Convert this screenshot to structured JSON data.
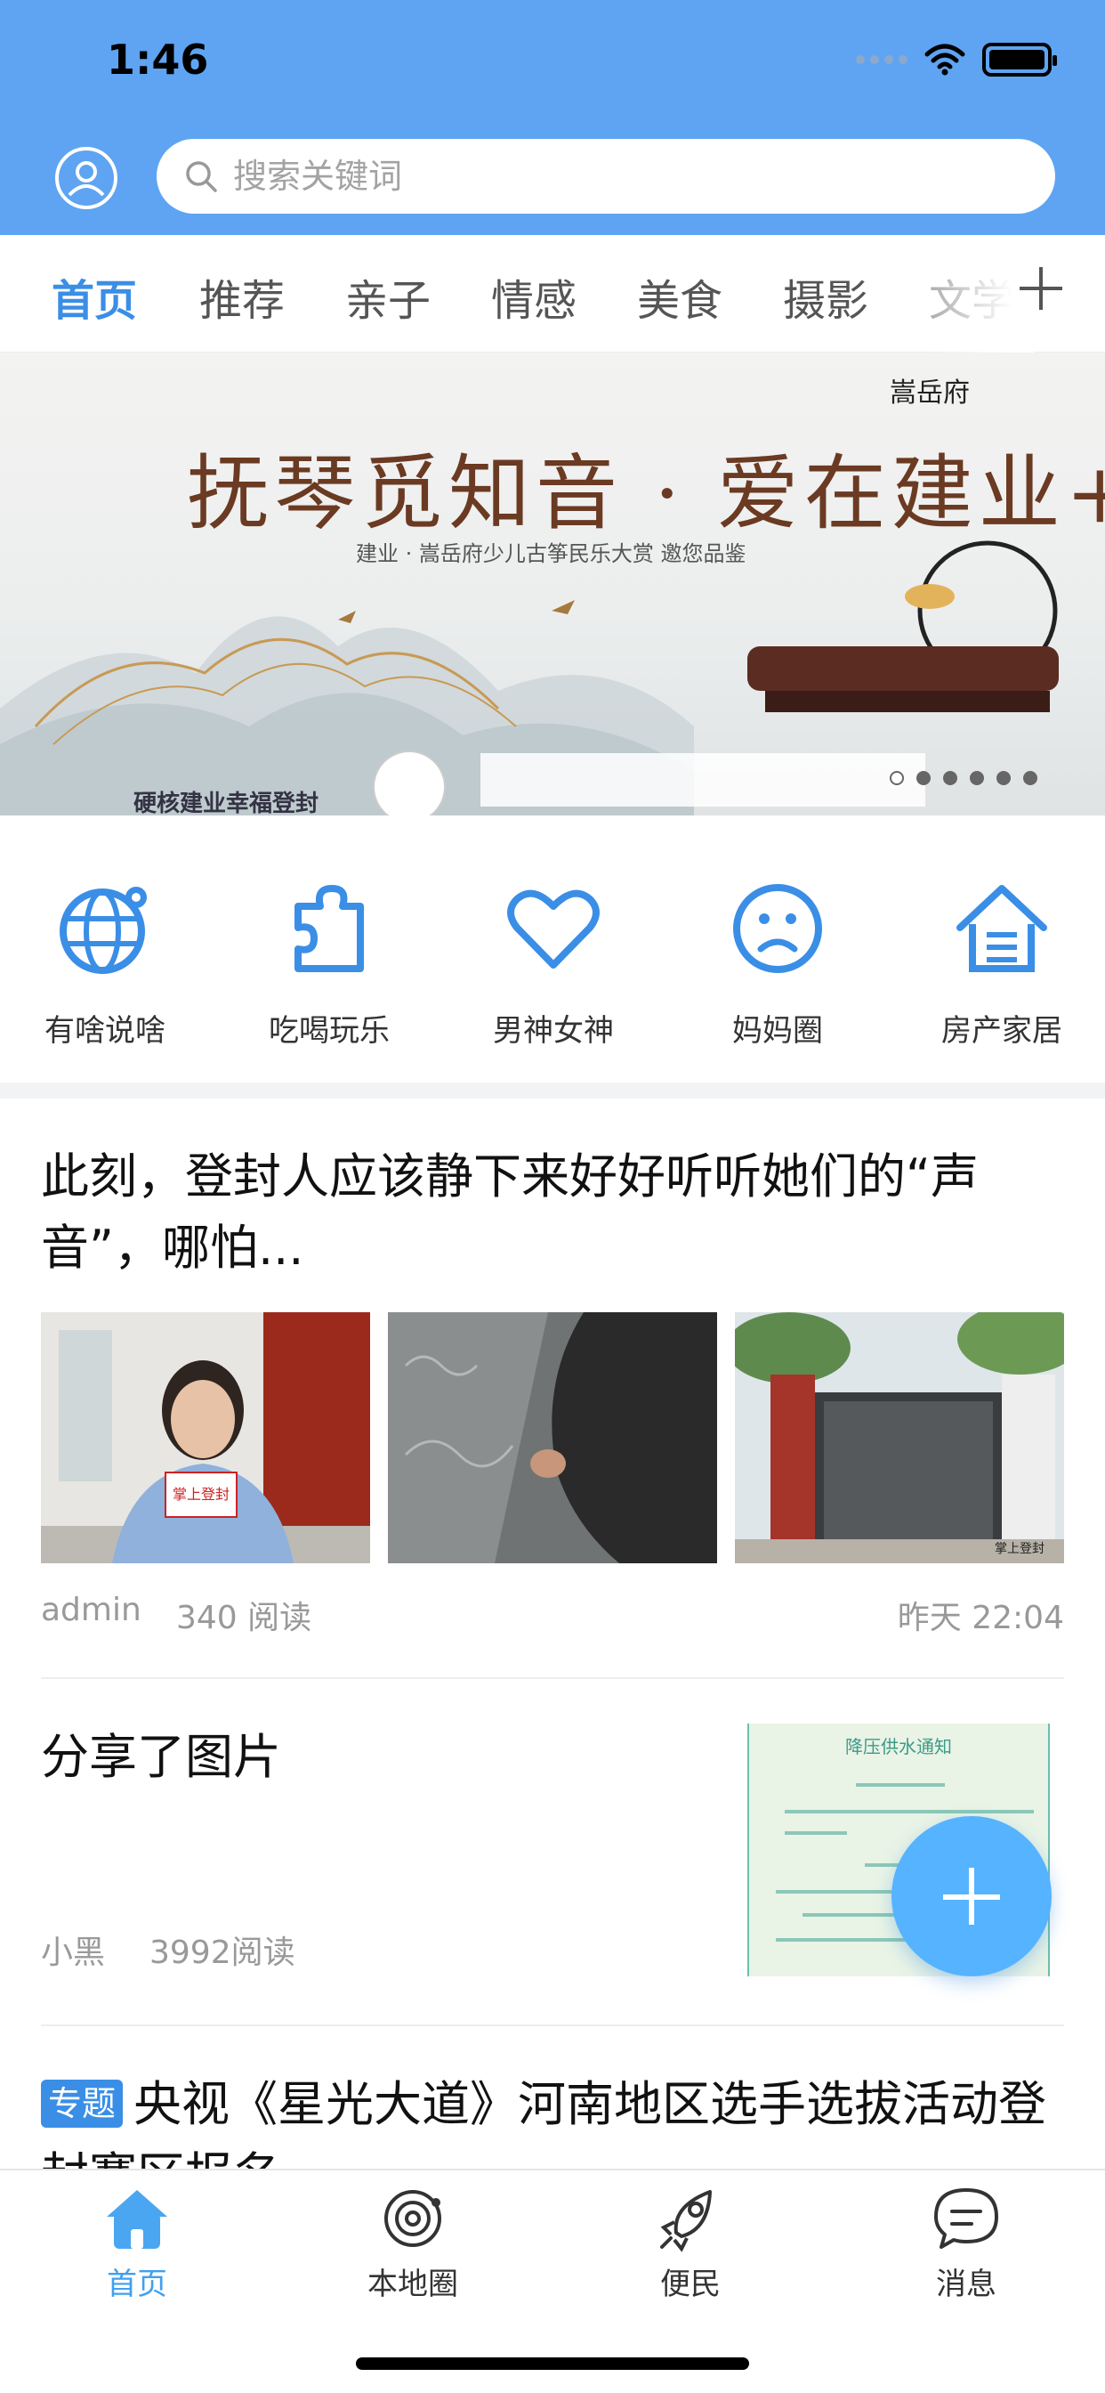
{
  "status": {
    "time": "1:46"
  },
  "search": {
    "placeholder": "搜索关键词"
  },
  "tabs": [
    "首页",
    "推荐",
    "亲子",
    "情感",
    "美食",
    "摄影",
    "文学"
  ],
  "banner": {
    "title": "抚琴觅知音 · 爱在建业+",
    "subtitle": "建业 · 嵩岳府少儿古筝民乐大赏 邀您品鉴",
    "slogan": "硬核建业幸福登封",
    "brand": "嵩岳府"
  },
  "quick_nav": [
    {
      "label": "有啥说啥",
      "icon": "globe-icon"
    },
    {
      "label": "吃喝玩乐",
      "icon": "puzzle-icon"
    },
    {
      "label": "男神女神",
      "icon": "heart-icon"
    },
    {
      "label": "妈妈圈",
      "icon": "sad-face-icon"
    },
    {
      "label": "房产家居",
      "icon": "house-icon"
    }
  ],
  "posts": [
    {
      "title": "此刻，登封人应该静下来好好听听她们的“声音”，哪怕...",
      "author": "admin",
      "reads": "340 阅读",
      "time": "昨天 22:04",
      "thumb_captions": [
        "掌上登封",
        "",
        "掌上登封"
      ]
    },
    {
      "title": "分享了图片",
      "author": "小黑",
      "reads": "3992阅读",
      "image_title": "降压供水通知"
    },
    {
      "badge": "专题",
      "title": "央视《星光大道》河南地区选手选拔活动登封赛区报名"
    }
  ],
  "tabbar": [
    {
      "label": "首页",
      "icon": "home-icon",
      "active": true
    },
    {
      "label": "本地圈",
      "icon": "planet-icon",
      "active": false
    },
    {
      "label": "便民",
      "icon": "rocket-icon",
      "active": false
    },
    {
      "label": "消息",
      "icon": "chat-bubble-icon",
      "active": false
    }
  ],
  "colors": {
    "header": "#5ea4f2",
    "accent": "#3a8ee6",
    "fab": "#56b3ff"
  }
}
